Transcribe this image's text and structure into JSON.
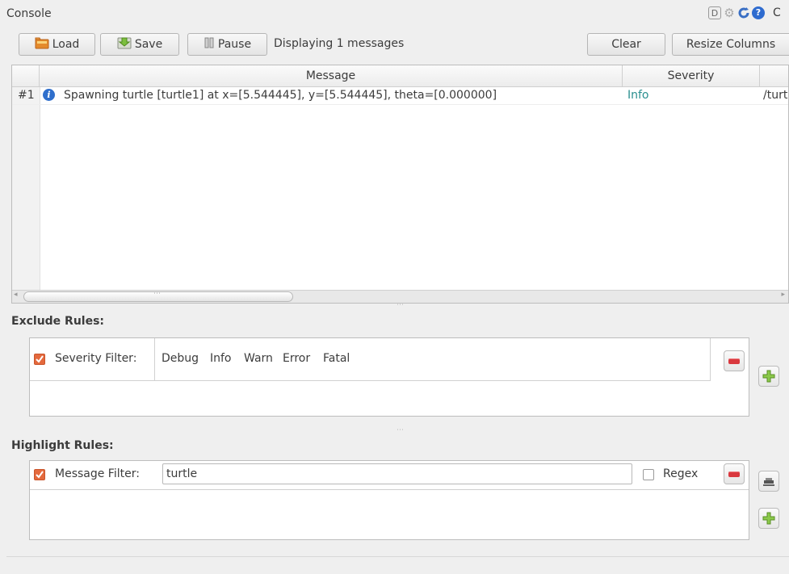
{
  "window": {
    "title": "Console",
    "title_cut": "C"
  },
  "toolbar": {
    "load_label": "Load",
    "save_label": "Save",
    "pause_label": "Pause",
    "status_text": "Displaying 1 messages",
    "clear_label": "Clear",
    "resize_label": "Resize Columns"
  },
  "corner_icons": [
    "d-icon",
    "gear-icon",
    "reload-icon",
    "help-icon"
  ],
  "corner_d_text": "D",
  "table": {
    "columns": [
      "Message",
      "Severity"
    ],
    "rows": [
      {
        "index": "#1",
        "icon": "info-icon",
        "message": "Spawning turtle [turtle1] at x=[5.544445], y=[5.544445], theta=[0.000000]",
        "severity": "Info",
        "node": "/turt"
      }
    ]
  },
  "exclude": {
    "label": "Exclude Rules:",
    "rules": [
      {
        "checked": true,
        "name": "Severity Filter:",
        "values": [
          "Debug",
          "Info",
          "Warn",
          "Error",
          "Fatal"
        ]
      }
    ]
  },
  "highlight": {
    "label": "Highlight Rules:",
    "rules": [
      {
        "checked": true,
        "name": "Message Filter:",
        "value": "turtle",
        "regex_label": "Regex",
        "regex_checked": false
      }
    ]
  },
  "colors": {
    "info": "#2a8f8f",
    "accent": "#e4693d"
  }
}
